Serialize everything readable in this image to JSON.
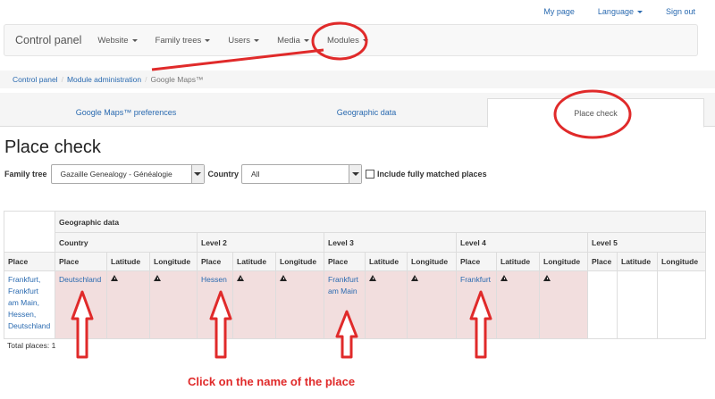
{
  "toplinks": {
    "my_page": "My page",
    "language": "Language",
    "signout": "Sign out"
  },
  "navbar": {
    "brand": "Control panel",
    "items": [
      "Website",
      "Family trees",
      "Users",
      "Media",
      "Modules"
    ]
  },
  "breadcrumb": {
    "item1": "Control panel",
    "item2": "Module administration",
    "current": "Google Maps™"
  },
  "tabs": {
    "prefs": "Google Maps™ preferences",
    "geo": "Geographic data",
    "check": "Place check"
  },
  "page_title": "Place check",
  "filters": {
    "tree_label": "Family tree",
    "tree_value": "Gazaille Genealogy - Généalogie",
    "country_label": "Country",
    "country_value": "All",
    "include_label": "Include fully matched places"
  },
  "table": {
    "h_place": "Place",
    "h_geo": "Geographic data",
    "h_country": "Country",
    "h_level2": "Level 2",
    "h_level3": "Level 3",
    "h_level4": "Level 4",
    "h_level5": "Level 5",
    "sub_place": "Place",
    "sub_lat": "Latitude",
    "sub_lon": "Longitude",
    "row_place": "Frankfurt, Frankfurt am Main, Hessen, Deutschland",
    "row_country": "Deutschland",
    "row_level2": "Hessen",
    "row_level3": "Frankfurt am Main",
    "row_level4": "Frankfurt"
  },
  "total": "Total places: 1",
  "annotation": {
    "caption": "Click on the name of the place",
    "color": "#e02a2a"
  }
}
